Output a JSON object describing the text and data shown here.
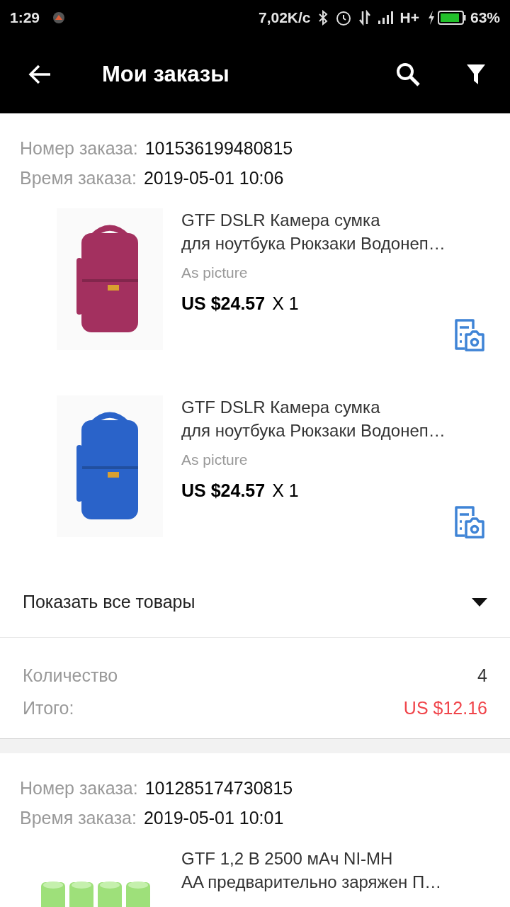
{
  "status_bar": {
    "time": "1:29",
    "speed": "7,02K/c",
    "network": "H+",
    "battery": "63%"
  },
  "app_bar": {
    "title": "Мои заказы"
  },
  "orders": [
    {
      "number_label": "Номер заказа:",
      "number": "101536199480815",
      "time_label": "Время заказа:",
      "time": "2019-05-01 10:06",
      "items": [
        {
          "title_lines": [
            "GTF DSLR Камера сумка",
            "для ноутбука Рюкзаки Водонеп…"
          ],
          "variant": "As picture",
          "price": "US $24.57",
          "quantity": "X 1"
        },
        {
          "title_lines": [
            "GTF DSLR Камера сумка",
            "для ноутбука Рюкзаки Водонеп…"
          ],
          "variant": "As picture",
          "price": "US $24.57",
          "quantity": "X 1"
        }
      ],
      "show_all": "Показать все товары",
      "count_label": "Количество",
      "count": "4",
      "total_label": "Итого:",
      "total": "US $12.16"
    },
    {
      "number_label": "Номер заказа:",
      "number": "101285174730815",
      "time_label": "Время заказа:",
      "time": "2019-05-01 10:01",
      "items": [
        {
          "title_lines": [
            "GTF 1,2 В 2500 мАч NI-MH",
            "AA предварительно заряжен П…"
          ]
        }
      ]
    }
  ]
}
